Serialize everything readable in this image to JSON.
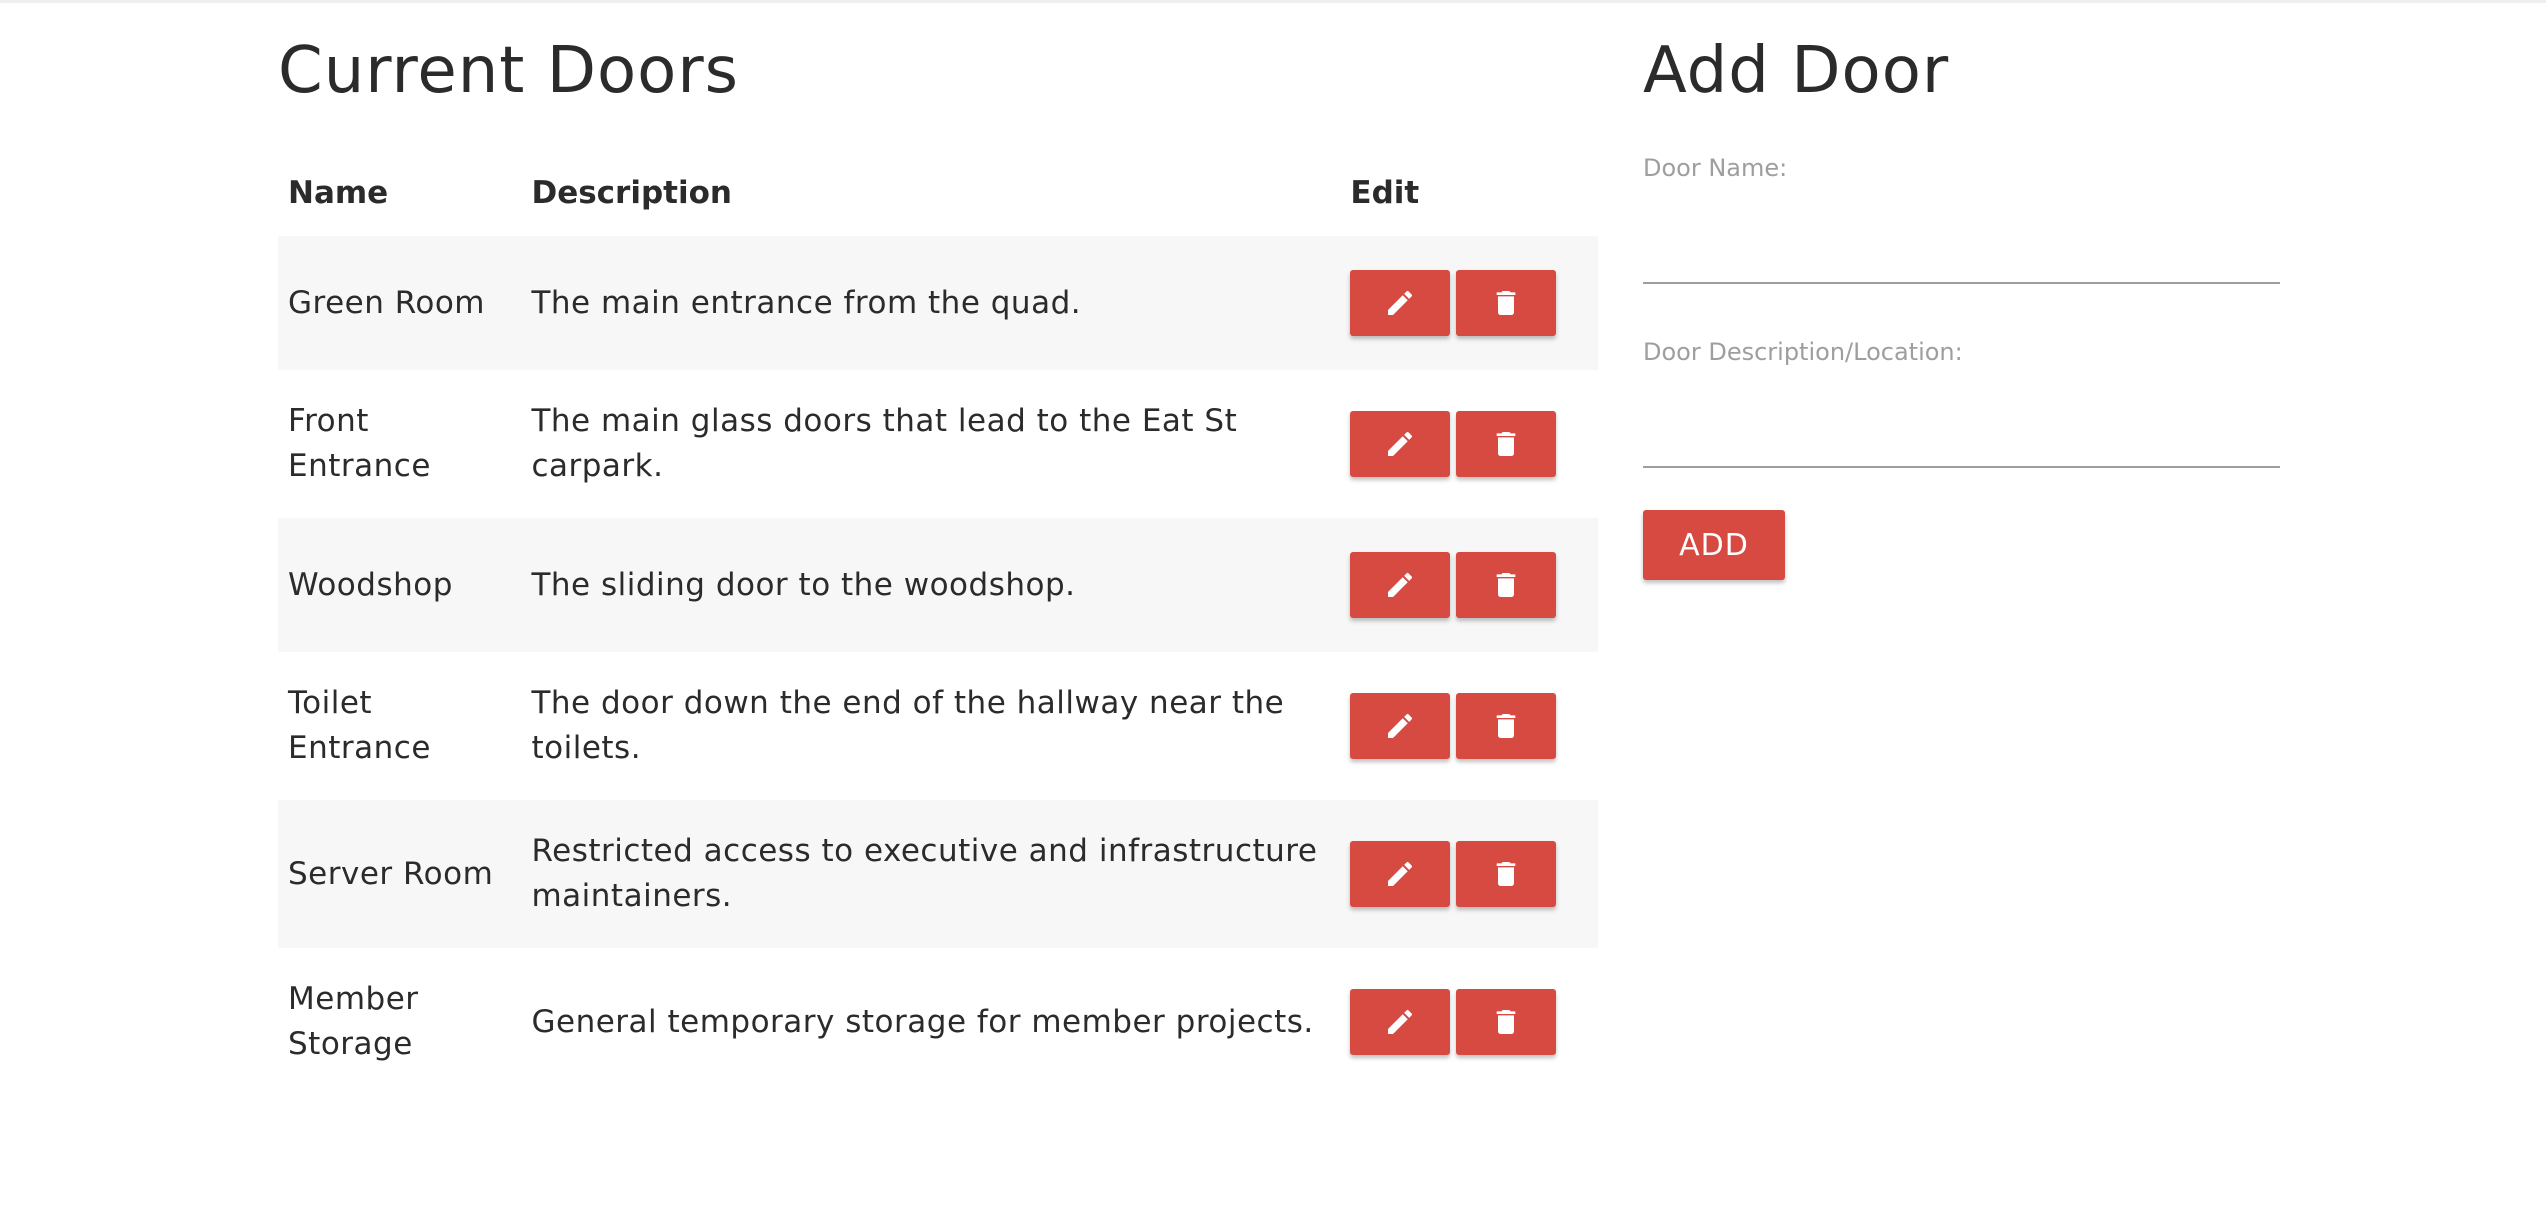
{
  "doors_section": {
    "title": "Current Doors",
    "columns": {
      "name": "Name",
      "description": "Description",
      "edit": "Edit"
    },
    "rows": [
      {
        "name": "Green Room",
        "description": "The main entrance from the quad."
      },
      {
        "name": "Front Entrance",
        "description": "The main glass doors that lead to the Eat St carpark."
      },
      {
        "name": "Woodshop",
        "description": "The sliding door to the woodshop."
      },
      {
        "name": "Toilet Entrance",
        "description": "The door down the end of the hallway near the toilets."
      },
      {
        "name": "Server Room",
        "description": "Restricted access to executive and infrastructure maintainers."
      },
      {
        "name": "Member Storage",
        "description": "General temporary storage for member projects."
      }
    ]
  },
  "add_section": {
    "title": "Add Door",
    "name_label": "Door Name:",
    "name_value": "",
    "description_label": "Door Description/Location:",
    "description_value": "",
    "add_label": "ADD"
  },
  "icons": {
    "edit": "pencil-icon",
    "delete": "trash-icon"
  },
  "colors": {
    "accent": "#d64a41",
    "row_stripe": "#f7f7f7",
    "label_gray": "#9e9e9e"
  }
}
